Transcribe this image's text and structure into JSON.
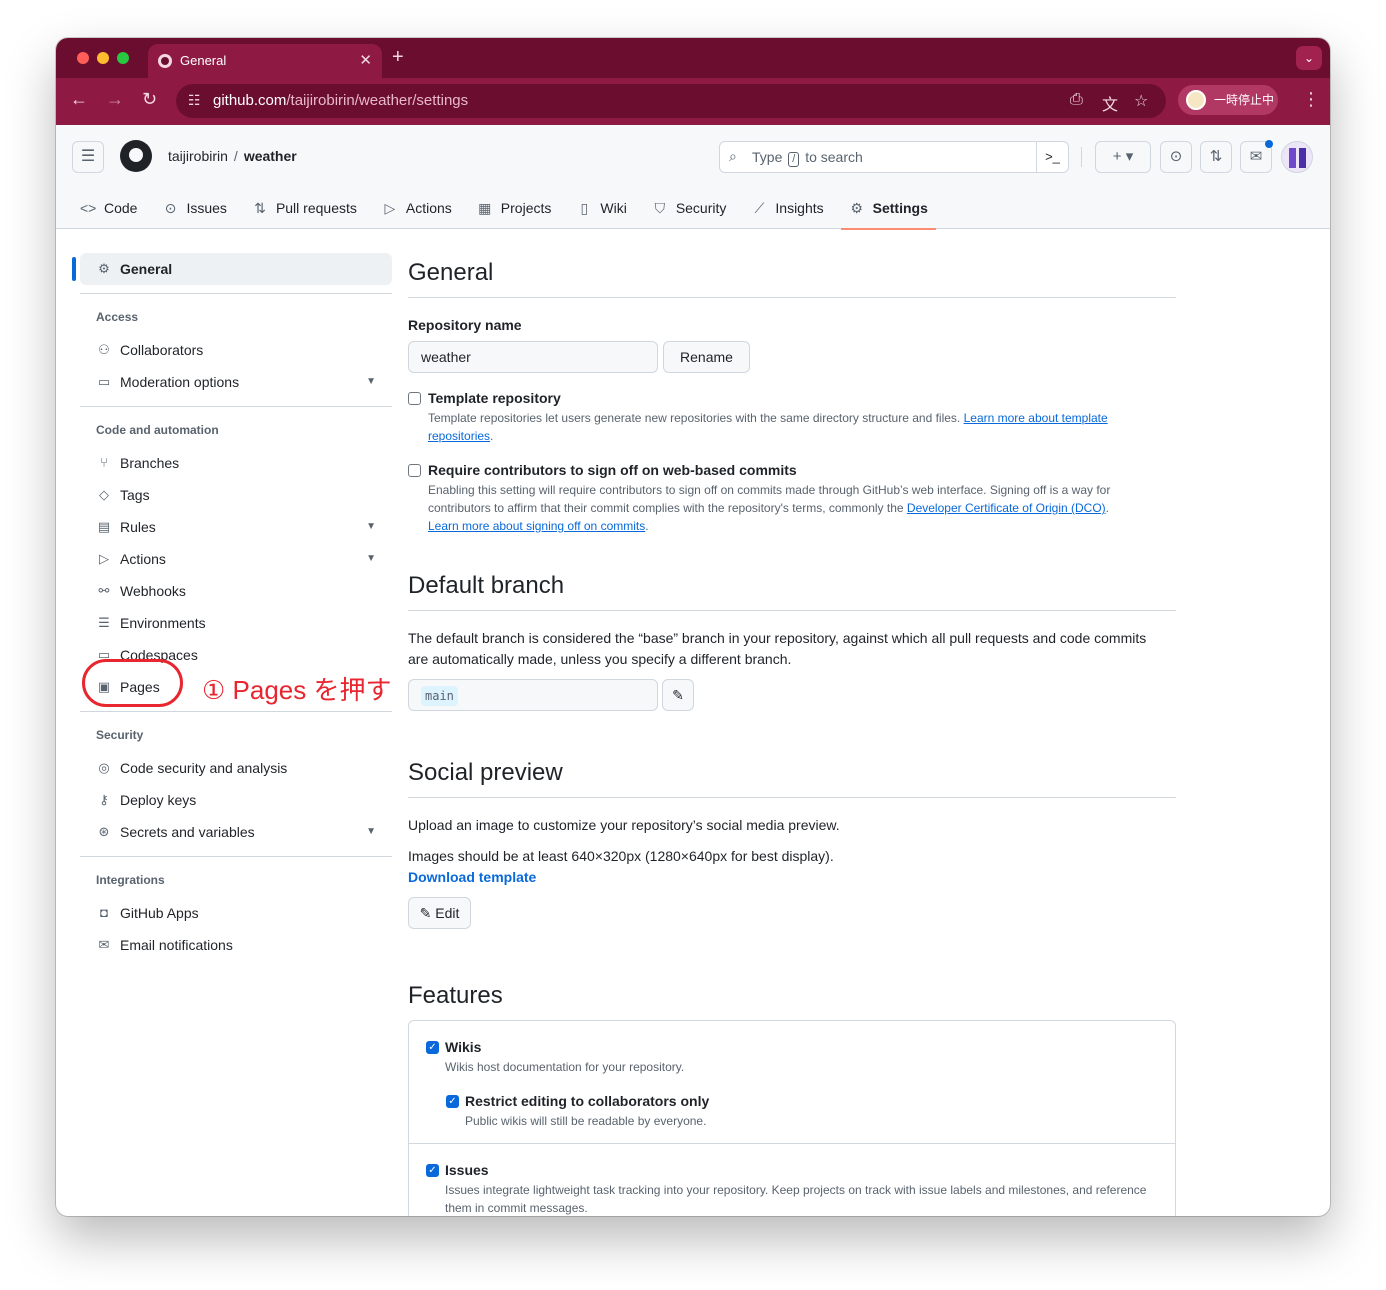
{
  "browser": {
    "tab_title": "General",
    "tab_close": "✕",
    "tab_new": "+",
    "tab_menu": "⌄",
    "url_host": "github.com",
    "url_path": "/taijirobirin/weather/settings",
    "profile_status": "一時停止中"
  },
  "header": {
    "owner": "taijirobirin",
    "separator": "/",
    "repo": "weather",
    "search_before": "Type",
    "search_key": "/",
    "search_after": "to search"
  },
  "reponav": [
    {
      "label": "Code",
      "icon": "code-icon",
      "glyph": "<>"
    },
    {
      "label": "Issues",
      "icon": "issue-icon",
      "glyph": "⊙"
    },
    {
      "label": "Pull requests",
      "icon": "pull-request-icon",
      "glyph": "⇅"
    },
    {
      "label": "Actions",
      "icon": "play-icon",
      "glyph": "▷"
    },
    {
      "label": "Projects",
      "icon": "table-icon",
      "glyph": "▦"
    },
    {
      "label": "Wiki",
      "icon": "book-icon",
      "glyph": "▯"
    },
    {
      "label": "Security",
      "icon": "shield-icon",
      "glyph": "⛉"
    },
    {
      "label": "Insights",
      "icon": "graph-icon",
      "glyph": "⟋"
    },
    {
      "label": "Settings",
      "icon": "gear-icon",
      "glyph": "⚙"
    }
  ],
  "sidebar": {
    "general": "General",
    "access_heading": "Access",
    "collaborators": "Collaborators",
    "moderation": "Moderation options",
    "code_heading": "Code and automation",
    "branches": "Branches",
    "tags": "Tags",
    "rules": "Rules",
    "actions": "Actions",
    "webhooks": "Webhooks",
    "environments": "Environments",
    "codespaces": "Codespaces",
    "pages": "Pages",
    "security_heading": "Security",
    "code_security": "Code security and analysis",
    "deploy_keys": "Deploy keys",
    "secrets": "Secrets and variables",
    "integrations_heading": "Integrations",
    "github_apps": "GitHub Apps",
    "email_notifications": "Email notifications"
  },
  "annotation": {
    "text": "① Pages を押す",
    "color": "#e7262f"
  },
  "general": {
    "title": "General",
    "repo_name_label": "Repository name",
    "repo_name_value": "weather",
    "rename_button": "Rename",
    "template_title": "Template repository",
    "template_desc": "Template repositories let users generate new repositories with the same directory structure and files.",
    "template_link": "Learn more about template repositories",
    "signoff_title": "Require contributors to sign off on web-based commits",
    "signoff_desc": "Enabling this setting will require contributors to sign off on commits made through GitHub’s web interface. Signing off is a way for contributors to affirm that their commit complies with the repository's terms, commonly the",
    "signoff_link1": "Developer Certificate of Origin (DCO)",
    "signoff_link2": "Learn more about signing off on commits"
  },
  "default_branch": {
    "title": "Default branch",
    "desc": "The default branch is considered the “base” branch in your repository, against which all pull requests and code commits are automatically made, unless you specify a different branch.",
    "branch": "main"
  },
  "social_preview": {
    "title": "Social preview",
    "desc1": "Upload an image to customize your repository’s social media preview.",
    "desc2": "Images should be at least 640×320px (1280×640px for best display).",
    "download": "Download template",
    "edit": "Edit"
  },
  "features": {
    "title": "Features",
    "wikis_title": "Wikis",
    "wikis_desc": "Wikis host documentation for your repository.",
    "restrict_title": "Restrict editing to collaborators only",
    "restrict_desc": "Public wikis will still be readable by everyone.",
    "issues_title": "Issues",
    "issues_desc": "Issues integrate lightweight task tracking into your repository. Keep projects on track with issue labels and milestones, and reference them in commit messages."
  }
}
